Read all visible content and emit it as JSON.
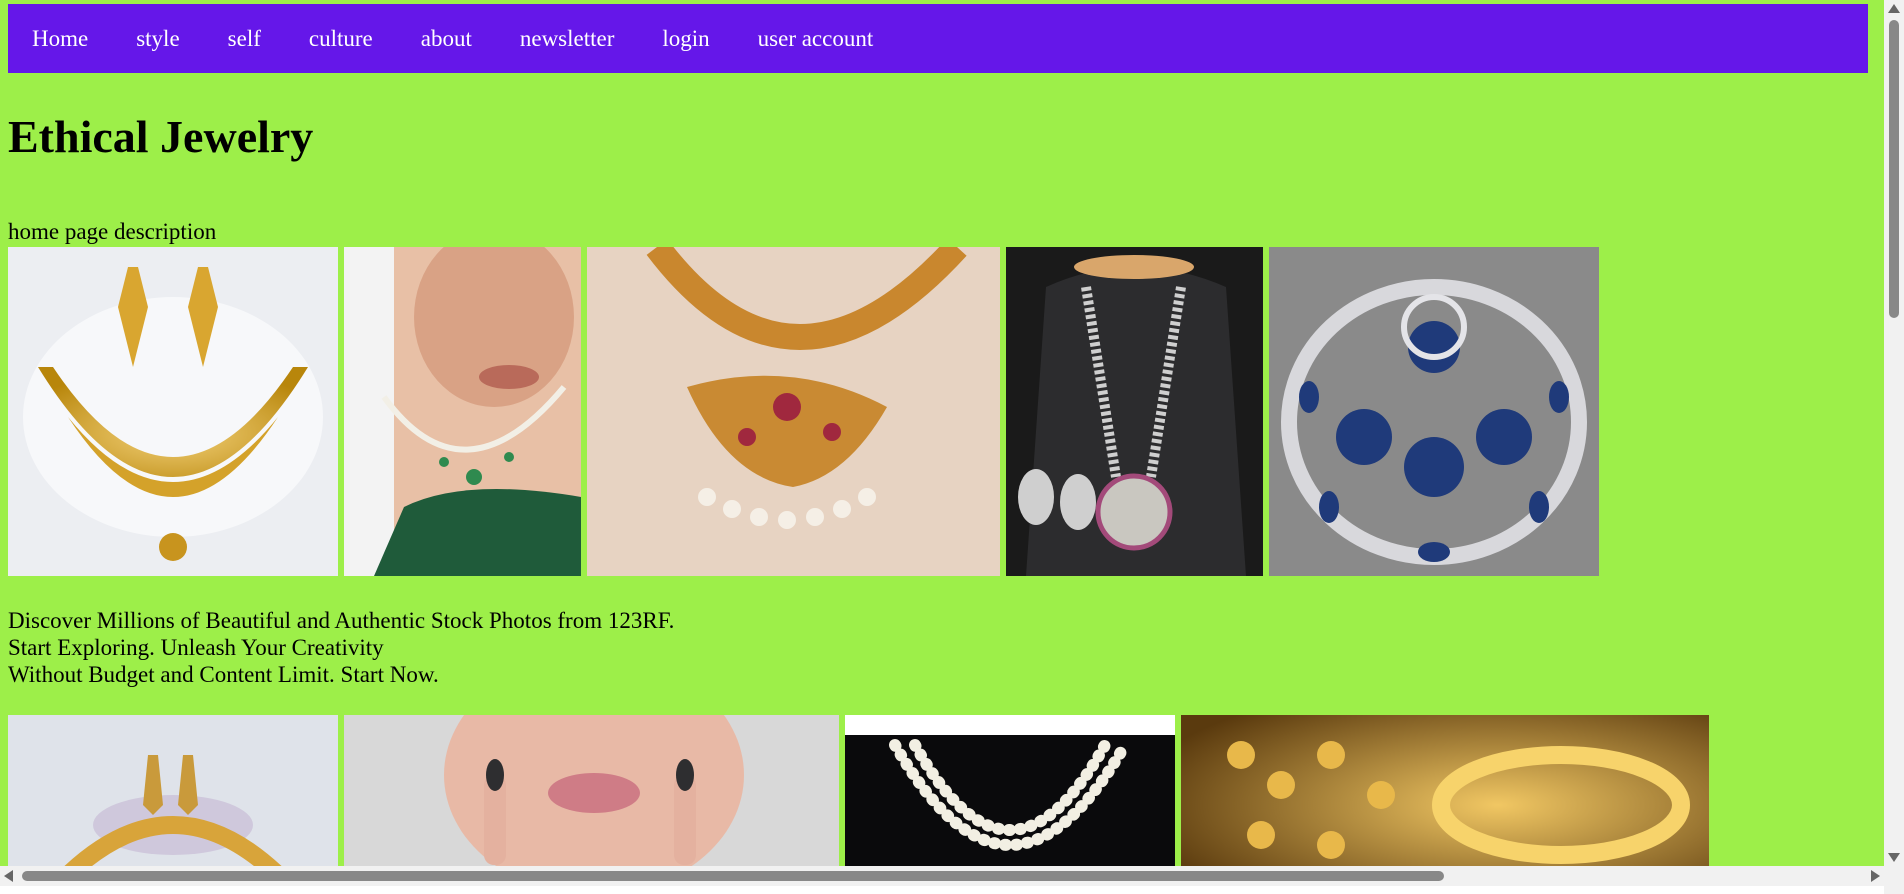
{
  "nav": {
    "items": [
      "Home",
      "style",
      "self",
      "culture",
      "about",
      "newsletter",
      "login",
      "user account"
    ]
  },
  "page": {
    "title": "Ethical Jewelry",
    "description": "home page description"
  },
  "promo": {
    "line1": "Discover Millions of Beautiful and Authentic Stock Photos from 123RF.",
    "line2": "Start Exploring. Unleash Your Creativity",
    "line3": "Without Budget and Content Limit. Start Now."
  },
  "colors": {
    "nav_bg": "#6517e9",
    "page_bg": "#9def49"
  },
  "images_row1": [
    "gold-necklace-earrings-set-image",
    "diamond-necklace-model-image",
    "gold-pendant-necklace-image",
    "silver-long-necklace-image",
    "sapphire-jewelry-set-image"
  ],
  "images_row2": [
    "gold-necklace-earrings-image",
    "model-lips-nails-image",
    "pearl-necklace-image",
    "gold-jewelry-pile-image"
  ]
}
